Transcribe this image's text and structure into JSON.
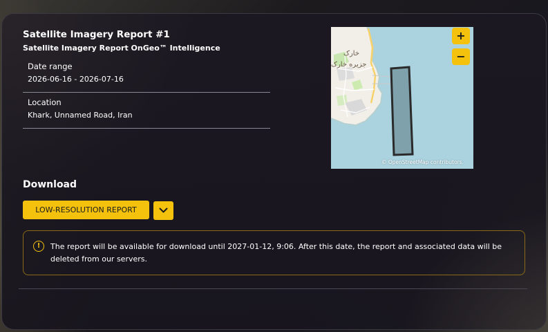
{
  "report": {
    "title": "Satellite Imagery Report #1",
    "subtitle": "Satellite Imagery Report OnGeo™ Intelligence"
  },
  "details": {
    "date_range_label": "Date range",
    "date_range_value": "2026-06-16 - 2026-07-16",
    "location_label": "Location",
    "location_value": "Khark, Unnamed Road, Iran"
  },
  "map": {
    "place_label_1": "خارک",
    "place_label_2": "جزیره خارک",
    "zoom_in": "+",
    "zoom_out": "−",
    "attribution": "© OpenStreetMap contributors."
  },
  "download": {
    "heading": "Download",
    "report_button": "LOW-RESOLUTION REPORT",
    "dropdown_icon": "chevron-down-icon"
  },
  "notice": {
    "icon": "!",
    "text": "The report will be available for download until 2027-01-12, 9:06. After this date, the report and associated data will be deleted from our servers."
  },
  "colors": {
    "accent": "#f4c20d",
    "card_bg": "#1c1822",
    "water": "#aad3df",
    "land": "#f2efe9"
  }
}
